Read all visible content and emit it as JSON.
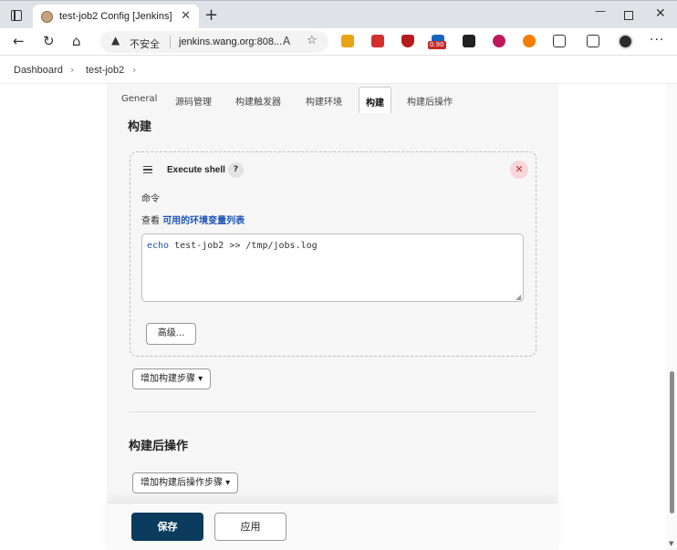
{
  "browser": {
    "tab_title": "test-job2 Config [Jenkins]",
    "tab_close": "✕",
    "new_tab": "+",
    "insecure_label": "不安全",
    "url": "jenkins.wang.org:808...",
    "ext_badge": "0.90",
    "icons": [
      "tabs-icon",
      "back-icon",
      "reload-icon",
      "home-icon",
      "warning-icon",
      "read-aloud-icon",
      "favorite-icon",
      "extension-icon",
      "collections-icon",
      "more-icon"
    ]
  },
  "breadcrumb": {
    "items": [
      "Dashboard",
      "test-job2"
    ],
    "arrow": "›"
  },
  "config_tabs": [
    "General",
    "源码管理",
    "构建触发器",
    "构建环境",
    "构建",
    "构建后操作"
  ],
  "active_tab": "构建",
  "build": {
    "section_title": "构建",
    "step": {
      "title": "Execute shell",
      "help": "?",
      "delete": "✕",
      "command_label": "命令",
      "env_prefix": "查看 ",
      "env_link": "可用的环境变量列表",
      "command_keyword": "echo",
      "command_rest": " test-job2 >> /tmp/jobs.log",
      "advanced_button": "高级..."
    },
    "add_step_button": "增加构建步骤 ▾"
  },
  "post_build": {
    "section_title": "构建后操作",
    "add_step_button": "增加构建后操作步骤 ▾"
  },
  "footer": {
    "save": "保存",
    "apply": "应用"
  },
  "colors": {
    "save_bg": "#0b3c5d",
    "link": "#1c53b8",
    "delete_bg": "#f8d7da"
  }
}
